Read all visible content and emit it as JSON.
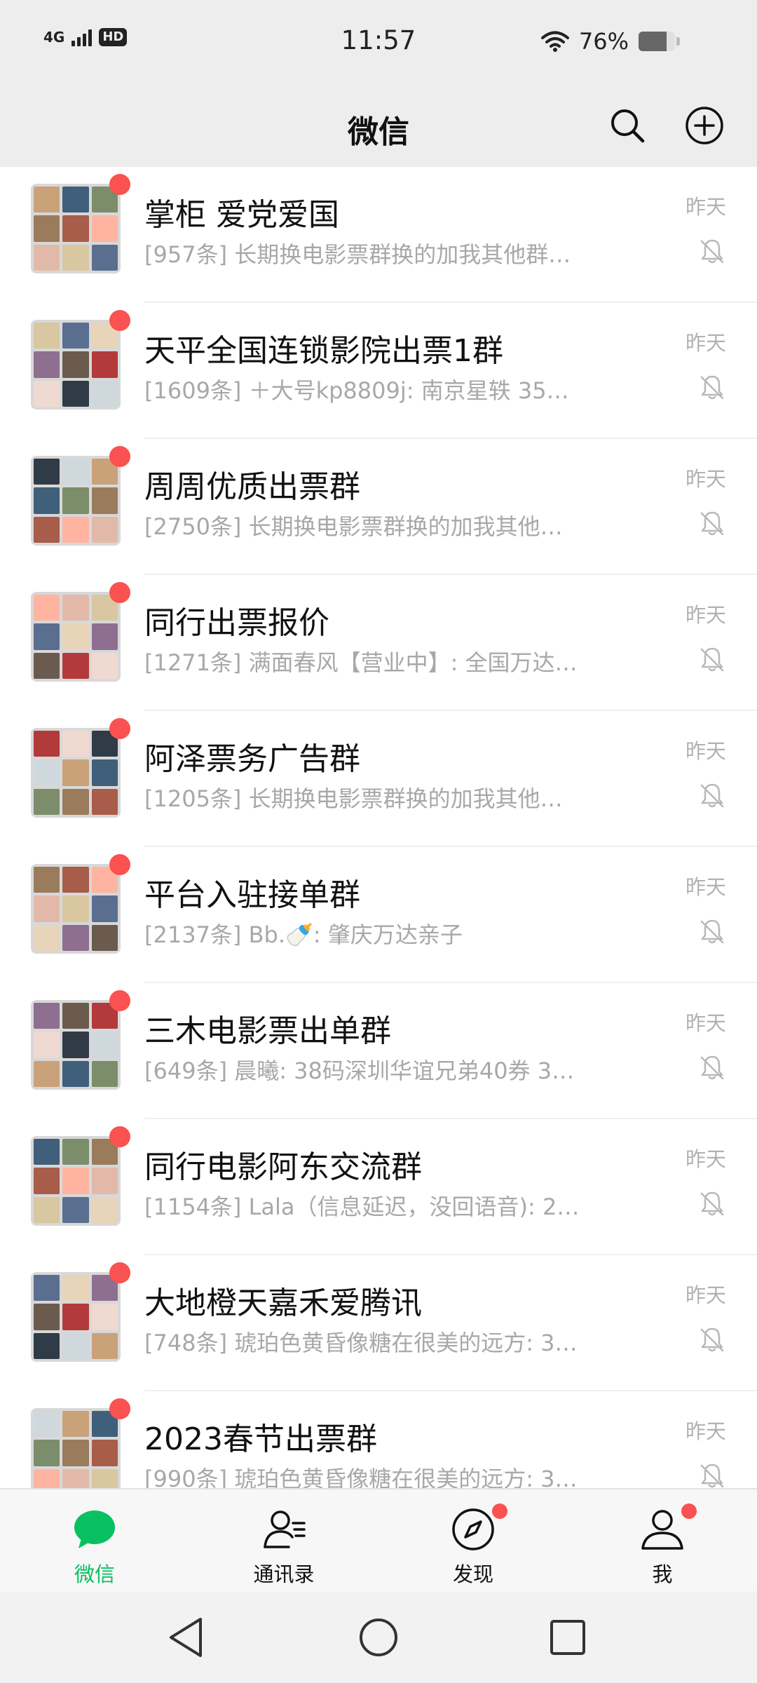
{
  "status_bar": {
    "network": "4G",
    "hd_badge": "HD",
    "time": "11:57",
    "battery_text": "76%",
    "battery_level": 0.76
  },
  "header": {
    "title": "微信"
  },
  "chats": [
    {
      "name": "掌柜 爱党爱国",
      "preview": "[957条] 长期换电影票群换的加我其他群…",
      "time": "昨天"
    },
    {
      "name": "天平全国连锁影院出票1群",
      "preview": "[1609条] ＋大号kp8809j: 南京星轶 35…",
      "time": "昨天"
    },
    {
      "name": "周周优质出票群",
      "preview": "[2750条] 长期换电影票群换的加我其他…",
      "time": "昨天"
    },
    {
      "name": "同行出票报价",
      "preview": "[1271条] 满面春风【营业中】: 全国万达…",
      "time": "昨天"
    },
    {
      "name": "阿泽票务广告群",
      "preview": "[1205条] 长期换电影票群换的加我其他…",
      "time": "昨天"
    },
    {
      "name": "平台入驻接单群",
      "preview": "[2137条] Bb.🍼: 肇庆万达亲子",
      "time": "昨天"
    },
    {
      "name": "三木电影票出单群",
      "preview": "[649条] 晨曦: 38码深圳华谊兄弟40券 3…",
      "time": "昨天"
    },
    {
      "name": "同行电影阿东交流群",
      "preview": "[1154条] Lala（信息延迟，没回语音): 2…",
      "time": "昨天"
    },
    {
      "name": "大地橙天嘉禾爱腾讯",
      "preview": "[748条] 琥珀色黄昏像糖在很美的远方: 3…",
      "time": "昨天"
    },
    {
      "name": "2023春节出票群",
      "preview": "[990条] 琥珀色黄昏像糖在很美的远方: 3…",
      "time": "昨天"
    }
  ],
  "tabs": [
    {
      "label": "微信",
      "icon": "chat-bubble-icon"
    },
    {
      "label": "通讯录",
      "icon": "contacts-icon"
    },
    {
      "label": "发现",
      "icon": "compass-icon"
    },
    {
      "label": "我",
      "icon": "person-icon"
    }
  ],
  "colors": {
    "accent": "#07c160",
    "badge": "#fa5151"
  }
}
